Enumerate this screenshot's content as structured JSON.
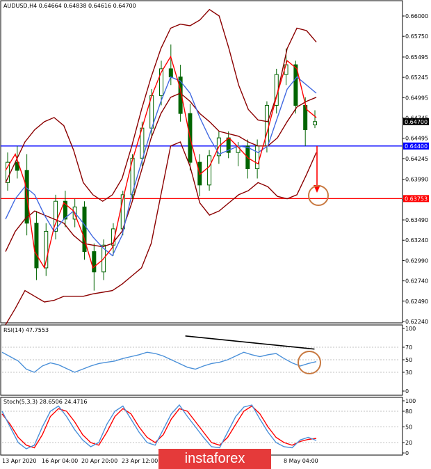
{
  "chart_data": [
    {
      "type": "line",
      "panel": "price",
      "title": "AUDUSD,H4  0.64664 0.64838 0.64616 0.64700",
      "ylim": [
        0.6224,
        0.6606
      ],
      "y_ticks": [
        "0.66000",
        "0.65750",
        "0.65495",
        "0.65245",
        "0.64995",
        "0.64745",
        "0.64495",
        "0.64245",
        "0.63990",
        "0.63740",
        "0.63490",
        "0.63240",
        "0.62990",
        "0.62740",
        "0.62490",
        "0.62240"
      ],
      "price_tags": [
        {
          "label": "0.64700",
          "value": 0.647,
          "bg": "#000000",
          "fg": "#ffffff"
        },
        {
          "label": "0.64400",
          "value": 0.644,
          "bg": "#0000ff",
          "fg": "#ffffff"
        },
        {
          "label": "0.63753",
          "value": 0.63753,
          "bg": "#ff0000",
          "fg": "#ffffff"
        }
      ],
      "levels": [
        {
          "value": 0.644,
          "color": "#0000ff"
        },
        {
          "value": 0.63753,
          "color": "#ff0000"
        }
      ],
      "x_labels": [
        "13 Apr 2020",
        "16 Apr 04:00",
        "20 Apr 20:00",
        "23 Apr 12:00",
        "8 May 04:00"
      ],
      "series": [
        {
          "color": "#8b0000",
          "role": "bollinger-upper",
          "values": [
            0.6395,
            0.642,
            0.6445,
            0.646,
            0.647,
            0.6475,
            0.6465,
            0.6435,
            0.6395,
            0.638,
            0.6372,
            0.638,
            0.64,
            0.644,
            0.6485,
            0.6525,
            0.656,
            0.6585,
            0.659,
            0.6588,
            0.6595,
            0.6608,
            0.66,
            0.656,
            0.6515,
            0.6485,
            0.6472,
            0.647,
            0.6505,
            0.656,
            0.6585,
            0.6582,
            0.6568
          ]
        },
        {
          "color": "#8b0000",
          "role": "bollinger-lower",
          "values": [
            0.622,
            0.624,
            0.6262,
            0.6255,
            0.6248,
            0.625,
            0.6255,
            0.6255,
            0.6255,
            0.6258,
            0.626,
            0.6262,
            0.627,
            0.628,
            0.629,
            0.632,
            0.638,
            0.644,
            0.6445,
            0.6415,
            0.637,
            0.6355,
            0.636,
            0.637,
            0.638,
            0.6385,
            0.6395,
            0.639,
            0.6378,
            0.6375,
            0.638,
            0.6405,
            0.6432
          ]
        },
        {
          "color": "#8b0000",
          "role": "bollinger-middle",
          "values": [
            0.631,
            0.6335,
            0.635,
            0.636,
            0.6355,
            0.635,
            0.6345,
            0.633,
            0.632,
            0.6318,
            0.6316,
            0.632,
            0.6335,
            0.637,
            0.641,
            0.645,
            0.648,
            0.65,
            0.6505,
            0.6495,
            0.648,
            0.647,
            0.6458,
            0.6455,
            0.6452,
            0.6445,
            0.644,
            0.644,
            0.645,
            0.647,
            0.6488,
            0.6495,
            0.65
          ]
        },
        {
          "color": "#4169e1",
          "role": "ma-slow",
          "values": [
            0.635,
            0.6375,
            0.639,
            0.638,
            0.6355,
            0.6335,
            0.635,
            0.636,
            0.6345,
            0.6328,
            0.6315,
            0.6305,
            0.633,
            0.638,
            0.642,
            0.646,
            0.6495,
            0.6525,
            0.652,
            0.6505,
            0.6475,
            0.645,
            0.643,
            0.6435,
            0.644,
            0.6438,
            0.6432,
            0.644,
            0.6475,
            0.651,
            0.6525,
            0.6515,
            0.6505
          ]
        },
        {
          "color": "#ff0000",
          "role": "ma-fast",
          "values": [
            0.641,
            0.643,
            0.6395,
            0.631,
            0.629,
            0.634,
            0.637,
            0.636,
            0.633,
            0.629,
            0.63,
            0.6315,
            0.637,
            0.642,
            0.646,
            0.65,
            0.653,
            0.655,
            0.651,
            0.645,
            0.6405,
            0.6415,
            0.644,
            0.645,
            0.6438,
            0.6425,
            0.6418,
            0.646,
            0.6505,
            0.6545,
            0.6535,
            0.6485,
            0.6475
          ]
        }
      ],
      "candles": [
        [
          0.6395,
          0.6432,
          0.6385,
          0.642
        ],
        [
          0.642,
          0.644,
          0.64,
          0.641
        ],
        [
          0.641,
          0.643,
          0.633,
          0.6345
        ],
        [
          0.6345,
          0.636,
          0.6275,
          0.629
        ],
        [
          0.629,
          0.6345,
          0.628,
          0.6335
        ],
        [
          0.6335,
          0.638,
          0.6325,
          0.6372
        ],
        [
          0.6372,
          0.6385,
          0.634,
          0.635
        ],
        [
          0.635,
          0.6375,
          0.634,
          0.6365
        ],
        [
          0.6365,
          0.6372,
          0.63,
          0.631
        ],
        [
          0.631,
          0.632,
          0.6262,
          0.6285
        ],
        [
          0.6285,
          0.6325,
          0.6275,
          0.6318
        ],
        [
          0.6318,
          0.6345,
          0.6305,
          0.6338
        ],
        [
          0.6338,
          0.6385,
          0.633,
          0.638
        ],
        [
          0.638,
          0.643,
          0.6375,
          0.6425
        ],
        [
          0.6425,
          0.647,
          0.6415,
          0.6462
        ],
        [
          0.6462,
          0.651,
          0.645,
          0.6502
        ],
        [
          0.6502,
          0.6545,
          0.649,
          0.6535
        ],
        [
          0.6535,
          0.6565,
          0.6515,
          0.6525
        ],
        [
          0.6525,
          0.654,
          0.647,
          0.648
        ],
        [
          0.648,
          0.6492,
          0.641,
          0.642
        ],
        [
          0.642,
          0.643,
          0.6378,
          0.6392
        ],
        [
          0.6392,
          0.6435,
          0.6385,
          0.6428
        ],
        [
          0.6428,
          0.6458,
          0.6418,
          0.645
        ],
        [
          0.645,
          0.6458,
          0.6425,
          0.6432
        ],
        [
          0.6432,
          0.6445,
          0.6415,
          0.644
        ],
        [
          0.644,
          0.6448,
          0.64,
          0.6412
        ],
        [
          0.6412,
          0.6448,
          0.64,
          0.644
        ],
        [
          0.644,
          0.6495,
          0.6432,
          0.649
        ],
        [
          0.649,
          0.6535,
          0.648,
          0.6528
        ],
        [
          0.6528,
          0.656,
          0.6515,
          0.654
        ],
        [
          0.654,
          0.6545,
          0.648,
          0.649
        ],
        [
          0.649,
          0.65,
          0.644,
          0.646
        ],
        [
          0.6466,
          0.6484,
          0.6462,
          0.647
        ]
      ]
    },
    {
      "type": "line",
      "panel": "rsi",
      "title": "RSI(14) 47.7553",
      "ylim": [
        0,
        100
      ],
      "y_ticks": [
        "100",
        "70",
        "50",
        "30",
        "0"
      ],
      "series": [
        {
          "color": "#4a90d9",
          "values": [
            62,
            55,
            48,
            35,
            30,
            40,
            45,
            42,
            36,
            30,
            35,
            40,
            44,
            46,
            48,
            52,
            55,
            58,
            62,
            60,
            56,
            50,
            44,
            38,
            35,
            40,
            44,
            46,
            50,
            56,
            62,
            58,
            55,
            58,
            60,
            52,
            45,
            40,
            44,
            47
          ]
        }
      ],
      "divergence_line": {
        "from": [
          0.64,
          88
        ],
        "to": [
          0.97,
          67
        ],
        "color": "#000000"
      }
    },
    {
      "type": "line",
      "panel": "stochastic",
      "title": "Stoch(5,3,3) 28.6506 24.4716",
      "ylim": [
        0,
        100
      ],
      "y_ticks": [
        "100",
        "80",
        "50",
        "20",
        "0"
      ],
      "series": [
        {
          "color": "#ff0000",
          "values": [
            75,
            55,
            30,
            15,
            10,
            35,
            70,
            85,
            80,
            60,
            35,
            20,
            15,
            40,
            70,
            85,
            75,
            50,
            30,
            20,
            35,
            65,
            85,
            80,
            60,
            40,
            20,
            15,
            30,
            55,
            80,
            90,
            75,
            50,
            30,
            20,
            15,
            22,
            26,
            28
          ]
        },
        {
          "color": "#4a90d9",
          "values": [
            80,
            50,
            20,
            8,
            15,
            50,
            80,
            90,
            70,
            45,
            25,
            12,
            20,
            55,
            80,
            90,
            65,
            40,
            20,
            15,
            45,
            75,
            92,
            70,
            50,
            30,
            12,
            10,
            40,
            70,
            88,
            92,
            65,
            40,
            20,
            12,
            10,
            25,
            30,
            24
          ]
        }
      ]
    }
  ],
  "watermark": "instaforex"
}
